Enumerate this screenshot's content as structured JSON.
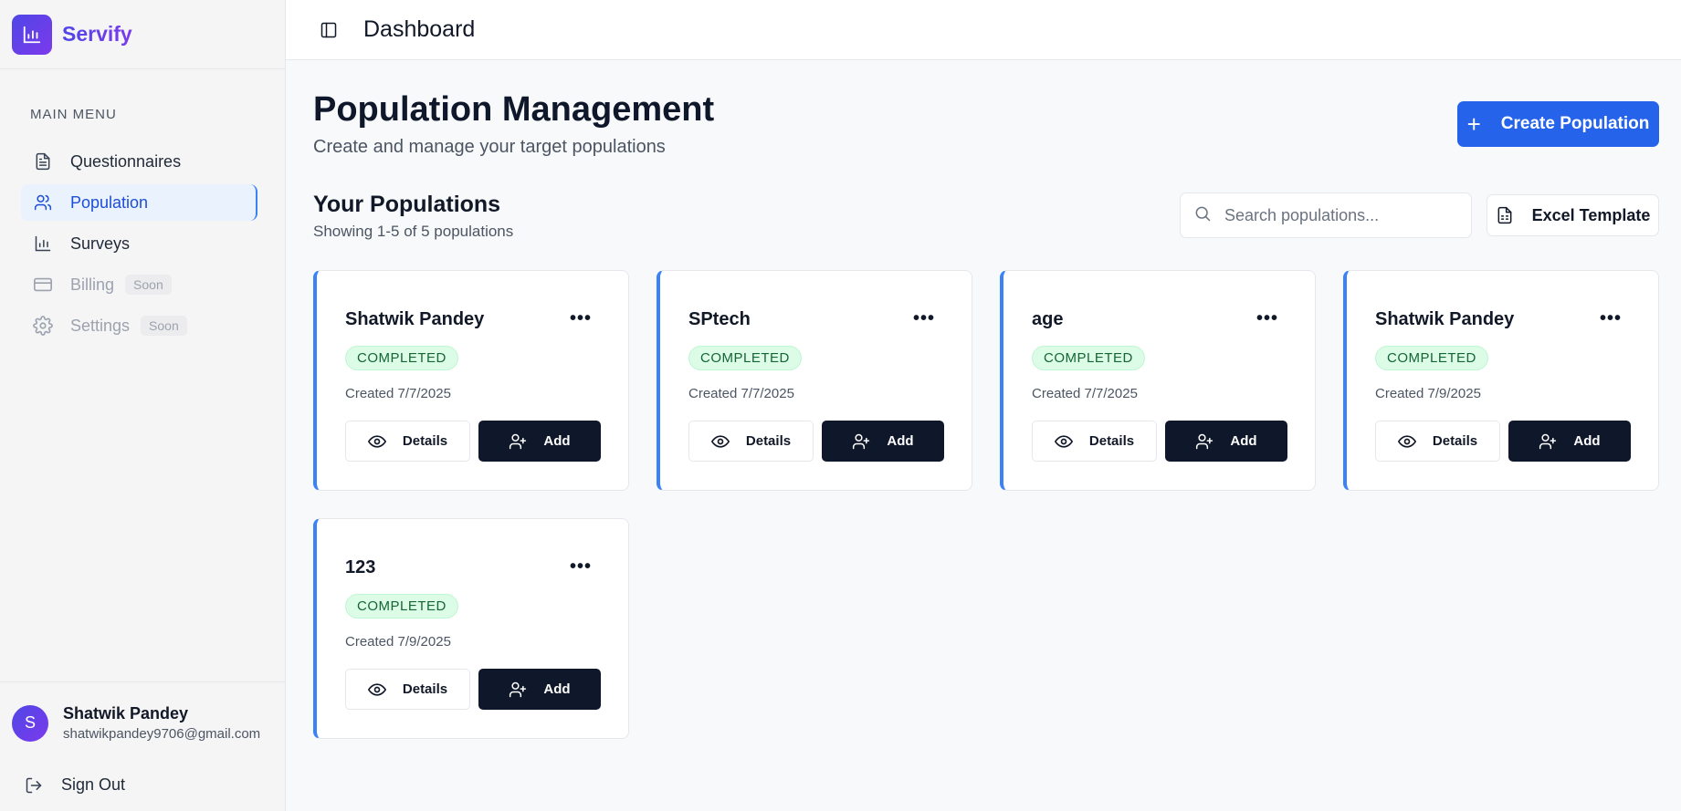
{
  "brand": {
    "name": "Servify",
    "logo_icon": "bar-chart-icon"
  },
  "sidebar": {
    "menu_heading": "MAIN MENU",
    "items": [
      {
        "label": "Questionnaires",
        "icon": "file-text-icon",
        "active": false,
        "disabled": false
      },
      {
        "label": "Population",
        "icon": "users-icon",
        "active": true,
        "disabled": false
      },
      {
        "label": "Surveys",
        "icon": "bar-chart-icon",
        "active": false,
        "disabled": false
      },
      {
        "label": "Billing",
        "icon": "credit-card-icon",
        "active": false,
        "disabled": true,
        "badge": "Soon"
      },
      {
        "label": "Settings",
        "icon": "gear-icon",
        "active": false,
        "disabled": true,
        "badge": "Soon"
      }
    ],
    "user": {
      "initial": "S",
      "name": "Shatwik Pandey",
      "email": "shatwikpandey9706@gmail.com"
    },
    "sign_out_label": "Sign Out"
  },
  "topbar": {
    "title": "Dashboard"
  },
  "header": {
    "title": "Population Management",
    "subtitle": "Create and manage your target populations",
    "create_label": "Create Population"
  },
  "populations_section": {
    "title": "Your Populations",
    "summary": "Showing 1-5 of 5 populations",
    "search_placeholder": "Search populations...",
    "excel_label": "Excel Template"
  },
  "cards": [
    {
      "name": "Shatwik Pandey",
      "status": "COMPLETED",
      "created": "Created 7/7/2025",
      "details_label": "Details",
      "add_label": "Add"
    },
    {
      "name": "SPtech",
      "status": "COMPLETED",
      "created": "Created 7/7/2025",
      "details_label": "Details",
      "add_label": "Add"
    },
    {
      "name": "age",
      "status": "COMPLETED",
      "created": "Created 7/7/2025",
      "details_label": "Details",
      "add_label": "Add"
    },
    {
      "name": "Shatwik Pandey",
      "status": "COMPLETED",
      "created": "Created 7/9/2025",
      "details_label": "Details",
      "add_label": "Add"
    },
    {
      "name": "123",
      "status": "COMPLETED",
      "created": "Created 7/9/2025",
      "details_label": "Details",
      "add_label": "Add"
    }
  ],
  "colors": {
    "accent": "#2563eb",
    "dark_button": "#0f172a",
    "status_green": "#166534",
    "brand_gradient_start": "#4f46e5",
    "brand_gradient_end": "#7c3aed"
  }
}
